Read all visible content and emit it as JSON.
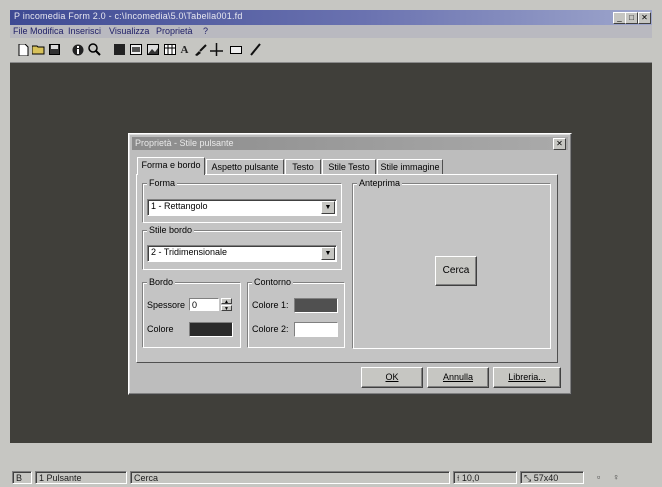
{
  "app": {
    "title": "P incomedia Form 2.0 - c:\\Incomedia\\5.0\\Tabella001.fd",
    "menu": [
      "File",
      "Modifica",
      "Inserisci",
      "Visualizza",
      "Proprietà",
      "?"
    ],
    "window_controls": [
      "_",
      "□",
      "✕"
    ]
  },
  "toolbar": {
    "icons": [
      "new-icon",
      "open-icon",
      "save-icon",
      "info-icon",
      "preview-icon",
      "shape-icon",
      "frame-icon",
      "image-icon",
      "table-icon",
      "text-icon",
      "brush-icon",
      "plus-icon",
      "rectangle-icon",
      "pen-icon"
    ]
  },
  "dialog": {
    "title": "Proprietà - Stile pulsante",
    "close": "✕",
    "tabs": [
      {
        "label": "Forma e bordo",
        "active": true
      },
      {
        "label": "Aspetto pulsante",
        "active": false
      },
      {
        "label": "Testo",
        "active": false
      },
      {
        "label": "Stile Testo",
        "active": false
      },
      {
        "label": "Stile immagine",
        "active": false
      }
    ],
    "forma": {
      "label": "Forma",
      "value": "1 - Rettangolo"
    },
    "stile_bordo": {
      "label": "Stile bordo",
      "value": "2 - Tridimensionale"
    },
    "bordo": {
      "label": "Bordo",
      "spessore_label": "Spessore",
      "spessore_value": "0",
      "colore_label": "Colore",
      "colore_value": "#2a2a2a"
    },
    "contorno": {
      "label": "Contorno",
      "colore1_label": "Colore 1:",
      "colore1_value": "#505050",
      "colore2_label": "Colore 2:",
      "colore2_value": "#ffffff"
    },
    "anteprima": {
      "label": "Anteprima",
      "button_label": "Cerca"
    },
    "buttons": {
      "ok": "OK",
      "annulla": "Annulla",
      "libreria": "Libreria..."
    }
  },
  "statusbar": {
    "mode": "B",
    "object": "1 Pulsante",
    "text": "Cerca",
    "pos": "10,0",
    "size": "57x40"
  },
  "colors": {
    "titlebar_start": "#3e4a93",
    "workspace": "#403f3a",
    "dialog_face": "#bdbdbd"
  }
}
